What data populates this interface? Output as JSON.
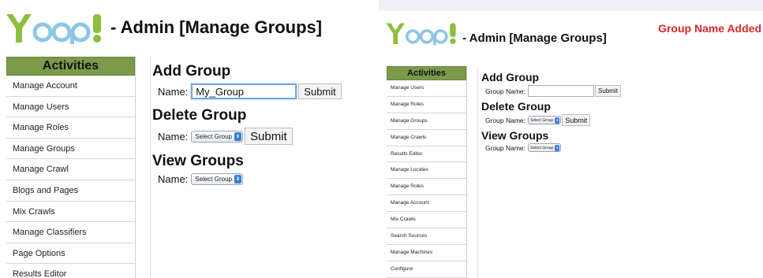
{
  "brand": {
    "logo_text": "Yoop!",
    "colors": {
      "logo_green": "#8cbf3f",
      "logo_blue": "#8ec6e6",
      "sidebar_header": "#7d9a4a",
      "alert_red": "#d8282a",
      "focus_blue": "#7aa7e0"
    }
  },
  "left": {
    "title": "- Admin [Manage Groups]",
    "sidebar": {
      "header": "Activities",
      "items": [
        {
          "label": "Manage Account"
        },
        {
          "label": "Manage Users"
        },
        {
          "label": "Manage Roles"
        },
        {
          "label": "Manage Groups"
        },
        {
          "label": "Manage Crawl"
        },
        {
          "label": "Blogs and Pages"
        },
        {
          "label": "Mix Crawls"
        },
        {
          "label": "Manage Classifiers"
        },
        {
          "label": "Page Options"
        },
        {
          "label": "Results Editor"
        }
      ]
    },
    "add_group": {
      "title": "Add Group",
      "label": "Name:",
      "value": "My_Group",
      "submit": "Submit"
    },
    "delete_group": {
      "title": "Delete Group",
      "label": "Name:",
      "select": "Select Group",
      "submit": "Submit"
    },
    "view_groups": {
      "title": "View Groups",
      "label": "Name:",
      "select": "Select Group"
    }
  },
  "right": {
    "title": "- Admin [Manage Groups]",
    "message": "Group Name Added",
    "sidebar": {
      "header": "Activities",
      "items": [
        {
          "label": "Manage Users"
        },
        {
          "label": "Manage Roles"
        },
        {
          "label": "Manage Groups"
        },
        {
          "label": "Manage Crawls"
        },
        {
          "label": "Results Editor"
        },
        {
          "label": "Manage Locales"
        },
        {
          "label": "Manage Roles"
        },
        {
          "label": "Manage Account"
        },
        {
          "label": "Mix Crawls"
        },
        {
          "label": "Search Sources"
        },
        {
          "label": "Manage Machines"
        },
        {
          "label": "Configure"
        }
      ]
    },
    "add_group": {
      "title": "Add Group",
      "label": "Group Name:",
      "value": "",
      "submit": "Submit"
    },
    "delete_group": {
      "title": "Delete Group",
      "label": "Group Name:",
      "select": "Select Group",
      "submit": "Submit"
    },
    "view_groups": {
      "title": "View Groups",
      "label": "Group Name:",
      "select": "Select Group"
    }
  }
}
